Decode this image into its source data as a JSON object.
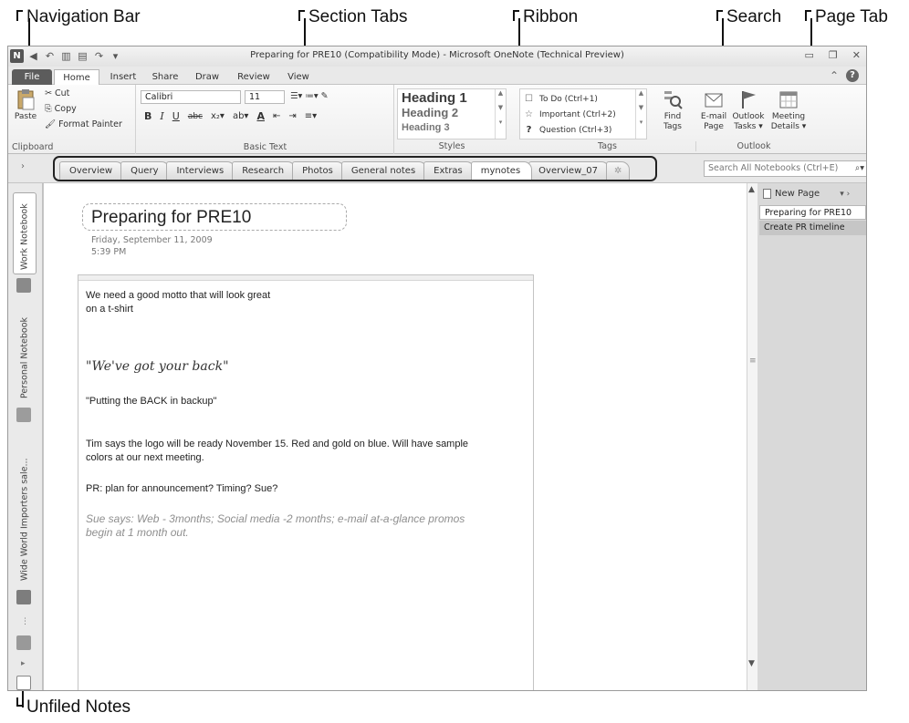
{
  "callouts": {
    "navigation_bar": "Navigation Bar",
    "section_tabs": "Section Tabs",
    "ribbon": "Ribbon",
    "search": "Search",
    "page_tab": "Page Tab",
    "unfiled_notes": "Unfiled Notes"
  },
  "window": {
    "title": "Preparing for PRE10 (Compatibility Mode)  -  Microsoft OneNote (Technical Preview)",
    "app_icon": "N"
  },
  "ribbon_tabs": [
    "File",
    "Home",
    "Insert",
    "Share",
    "Draw",
    "Review",
    "View"
  ],
  "ribbon": {
    "clipboard": {
      "paste": "Paste",
      "cut": "Cut",
      "copy": "Copy",
      "format_painter": "Format Painter",
      "label": "Clipboard"
    },
    "basic_text": {
      "font": "Calibri",
      "size": "11",
      "label": "Basic Text"
    },
    "styles": {
      "heading1": "Heading 1",
      "heading2": "Heading 2",
      "heading3": "Heading 3",
      "label": "Styles"
    },
    "tags": {
      "todo": "To Do (Ctrl+1)",
      "important": "Important (Ctrl+2)",
      "question": "Question (Ctrl+3)",
      "find_tags": "Find Tags",
      "label": "Tags"
    },
    "outlook": {
      "email_page": "E-mail Page",
      "outlook_tasks": "Outlook Tasks ▾",
      "meeting_details": "Meeting Details ▾",
      "label": "Outlook"
    }
  },
  "section_tabs": [
    "Overview",
    "Query",
    "Interviews",
    "Research",
    "Photos",
    "General notes",
    "Extras",
    "mynotes",
    "Overview_07"
  ],
  "active_section": "mynotes",
  "search": {
    "placeholder": "Search All Notebooks (Ctrl+E)"
  },
  "notebooks": [
    "Work Notebook",
    "Personal Notebook",
    "Wide World Importers sale..."
  ],
  "notebook_colors": {
    "work": "#8a8a8a",
    "personal": "#9c9c9c",
    "wideworld": "#7d7d7d"
  },
  "page": {
    "title": "Preparing for PRE10",
    "date": "Friday, September 11, 2009",
    "time": "5:39 PM",
    "notes": [
      "We need a good motto that will look great",
      "on a t-shirt",
      "\"We've got your back\"",
      "\"Putting the BACK in backup\"",
      "Tim says the logo will be ready November 15. Red and gold on blue. Will have sample",
      "colors at our next meeting.",
      "PR: plan for announcement? Timing? Sue?",
      "Sue says: Web - 3months; Social media  -2 months; e-mail at-a-glance promos",
      "begin at 1 month out."
    ]
  },
  "page_pane": {
    "new_page": "New Page",
    "pages": [
      "Preparing for PRE10",
      "Create PR timeline"
    ]
  }
}
